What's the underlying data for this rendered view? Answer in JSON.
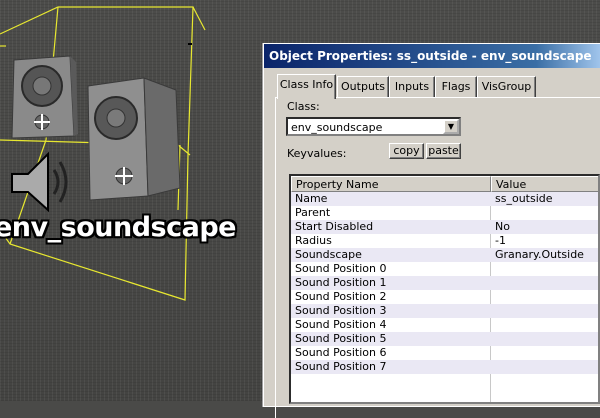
{
  "viewport": {
    "entity_label": "env_soundscape"
  },
  "dialog": {
    "title": "Object Properties: ss_outside - env_soundscape",
    "tabs": [
      "Class Info",
      "Outputs",
      "Inputs",
      "Flags",
      "VisGroup"
    ],
    "active_tab": "Class Info",
    "class_label": "Class:",
    "class_value": "env_soundscape",
    "keyvalues_label": "Keyvalues:",
    "copy_label": "copy",
    "paste_label": "paste",
    "columns": [
      "Property Name",
      "Value"
    ],
    "rows": [
      {
        "name": "Name",
        "value": "ss_outside"
      },
      {
        "name": "Parent",
        "value": ""
      },
      {
        "name": "Start Disabled",
        "value": "No"
      },
      {
        "name": "Radius",
        "value": "-1"
      },
      {
        "name": "Soundscape",
        "value": "Granary.Outside"
      },
      {
        "name": "Sound Position 0",
        "value": ""
      },
      {
        "name": "Sound Position 1",
        "value": ""
      },
      {
        "name": "Sound Position 2",
        "value": ""
      },
      {
        "name": "Sound Position 3",
        "value": ""
      },
      {
        "name": "Sound Position 4",
        "value": ""
      },
      {
        "name": "Sound Position 5",
        "value": ""
      },
      {
        "name": "Sound Position 6",
        "value": ""
      },
      {
        "name": "Sound Position 7",
        "value": ""
      }
    ]
  },
  "colors": {
    "wireframe": "#e8e830",
    "titlebar": "#0a246a",
    "dialog_face": "#d4d0c8",
    "alt_row": "#eae8f4"
  }
}
